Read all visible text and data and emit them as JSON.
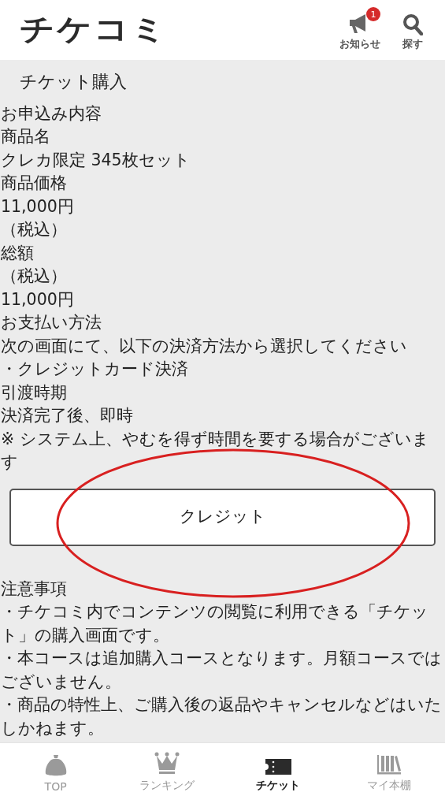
{
  "header": {
    "logo": "チケコミ",
    "actions": [
      {
        "kind": "notice",
        "label": "お知らせ",
        "badge": "1"
      },
      {
        "kind": "search",
        "label": "探す"
      }
    ]
  },
  "page_title": "チケット購入",
  "details": [
    "お申込み内容",
    "商品名",
    "クレカ限定 345枚セット",
    "商品価格",
    "11,000円",
    "（税込）",
    "総額",
    "（税込）",
    "11,000円",
    "お支払い方法",
    "次の画面にて、以下の決済方法から選択してください",
    "・クレジットカード決済",
    "引渡時期",
    "決済完了後、即時",
    "※ システム上、やむを得ず時間を要する場合がございます"
  ],
  "button": "クレジット",
  "notes_heading": "注意事項",
  "notes": [
    "・チケコミ内でコンテンツの閲覧に利用できる「チケット」の購入画面です。",
    "・本コースは追加購入コースとなります。月額コースではございません。",
    "・商品の特性上、ご購入後の返品やキャンセルなどはいたしかねます。"
  ],
  "nav": [
    {
      "kind": "top",
      "label": "TOP",
      "selected": false
    },
    {
      "kind": "ranking",
      "label": "ランキング",
      "selected": false
    },
    {
      "kind": "ticket",
      "label": "チケット",
      "selected": true
    },
    {
      "kind": "shelf",
      "label": "マイ本棚",
      "selected": false
    }
  ]
}
